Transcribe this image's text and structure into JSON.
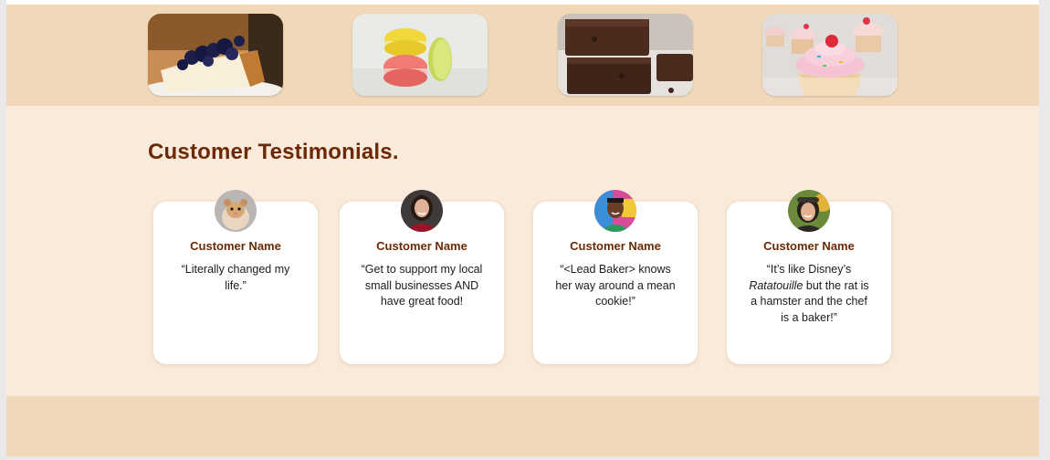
{
  "gallery": {
    "images": [
      {
        "icon": "cheesecake-photo"
      },
      {
        "icon": "macarons-photo"
      },
      {
        "icon": "brownies-photo"
      },
      {
        "icon": "cupcakes-photo"
      }
    ]
  },
  "testimonials": {
    "title": "Customer Testimonials.",
    "cards": [
      {
        "name": "Customer Name",
        "quote": "“Literally changed my life.”",
        "avatar": "hamster-avatar"
      },
      {
        "name": "Customer Name",
        "quote": "“Get to support my local small businesses AND have great food!",
        "avatar": "woman-avatar"
      },
      {
        "name": "Customer Name",
        "quote": "“<Lead Baker> knows her way around a mean cookie!”",
        "avatar": "man-avatar"
      },
      {
        "name": "Customer Name",
        "quote_before": "“It’s like Disney’s ",
        "quote_italic": "Ratatouille",
        "quote_after": " but the rat is a hamster and the chef is a baker!”",
        "avatar": "smiling-woman-avatar"
      }
    ]
  },
  "colors": {
    "gallery_bg": "#f0d8b8",
    "section_bg": "#faeadb",
    "heading": "#6b2a05",
    "card_bg": "#ffffff"
  }
}
